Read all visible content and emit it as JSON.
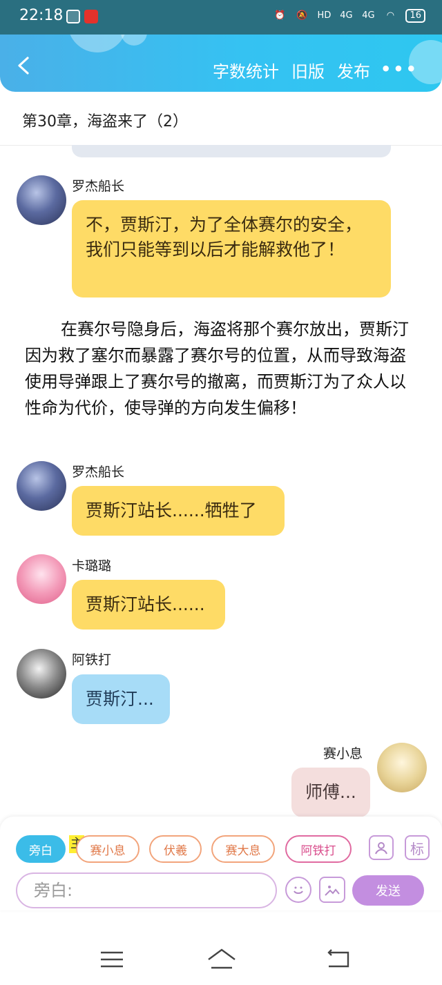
{
  "status_bar": {
    "time": "22:18",
    "network1": "HD",
    "network2": "4G",
    "network3": "4G",
    "battery": "16"
  },
  "header": {
    "actions": [
      "字数统计",
      "旧版",
      "发布"
    ],
    "more": "•••"
  },
  "chapter_title": "第30章，海盗来了（2）",
  "messages": [
    {
      "name": "罗杰船长",
      "text": "不，贾斯汀，为了全体赛尔的安全，我们只能等到以后才能解救他了！"
    },
    {
      "name": "罗杰船长",
      "text": "贾斯汀站长......牺牲了"
    },
    {
      "name": "卡璐璐",
      "text": "贾斯汀站长......"
    },
    {
      "name": "阿铁打",
      "text": "贾斯汀..."
    },
    {
      "name": "赛小息",
      "text": "师傅..."
    }
  ],
  "narration": "在赛尔号隐身后，海盗将那个赛尔放出，贾斯汀因为救了塞尔而暴露了赛尔号的位置，从而导致海盗使用导弹跟上了赛尔号的撤离，而贾斯汀为了众人以性命为代价，使导弹的方向发生偏移！",
  "composer": {
    "active_role": "旁白",
    "main_tag": "主",
    "roles": [
      "赛小息",
      "伏羲",
      "赛大息",
      "阿铁打"
    ],
    "side_buttons": [
      "标"
    ],
    "input_placeholder": "旁白:",
    "send_label": "发送"
  },
  "colors": {
    "header": "#35c2f2",
    "yellow_bubble": "#fedb66",
    "blue_bubble": "#a7dcf7",
    "pink_bubble": "#f4dedd",
    "send": "#c38ee0"
  }
}
